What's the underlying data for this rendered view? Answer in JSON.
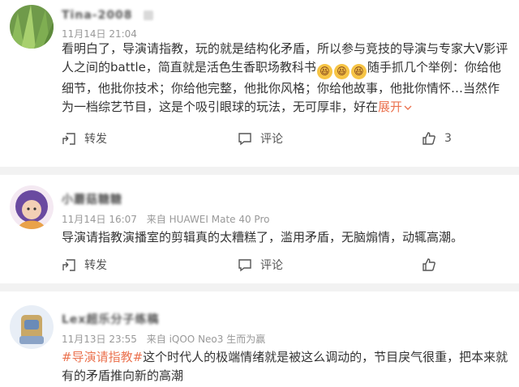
{
  "comments": [
    {
      "username": "Tina-2008",
      "timestamp": "11月14日 21:04",
      "source": "",
      "text_parts": [
        "看明白了，导演请指教，玩的就是结构化矛盾，所以参与竞技的导演与专家大V影评人之间的battle，简直就是活色生香职场教科书",
        "随手抓几个举例：你给他细节，他批你技术；你给他完整，他批你风格；你给他故事，他批你情怀…当然作为一档综艺节目，这是个吸引眼球的玩法，无可厚非，好在"
      ],
      "emoji_icons": [
        "laughing-emoji",
        "laughing-emoji",
        "laughing-emoji"
      ],
      "expand_label": "展开",
      "repost_label": "转发",
      "comment_label": "评论",
      "like_count": "3"
    },
    {
      "username": "小蘑菇糖糖",
      "timestamp": "11月14日 16:07",
      "source": "来自 HUAWEI Mate 40 Pro",
      "text": "导演请指教演播室的剪辑真的太糟糕了，滥用矛盾，无脑煽情，动辄高潮。",
      "repost_label": "转发",
      "comment_label": "评论",
      "like_count": ""
    },
    {
      "username": "Lex超乐分子练稿",
      "timestamp": "11月13日 23:55",
      "source": "来自 iQOO Neo3 生而为赢",
      "hashtag": "#导演请指教#",
      "text": "这个时代人的极端情绪就是被这么调动的，节目戾气很重，把本来就有的矛盾推向新的高潮"
    }
  ],
  "colors": {
    "accent": "#eb7350",
    "meta": "#999999",
    "text": "#333333",
    "background": "#f2f2f2"
  }
}
